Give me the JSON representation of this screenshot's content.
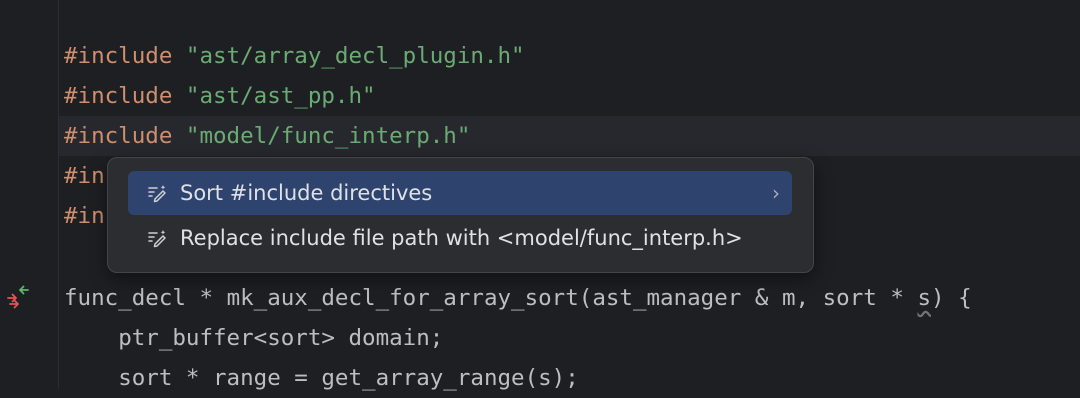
{
  "editor": {
    "lines": [
      {
        "directive": "#include",
        "path": "\"ast/array_decl_plugin.h\""
      },
      {
        "directive": "#include",
        "path": "\"ast/ast_pp.h\""
      },
      {
        "directive": "#include",
        "path": "\"model/func_interp.h\""
      },
      {
        "directive": "#in",
        "path": ""
      },
      {
        "directive": "#in",
        "path": ""
      }
    ],
    "func_line": {
      "ret_type": "func_decl",
      "star1": " * ",
      "name": "mk_aux_decl_for_array_sort",
      "paren_open": "(",
      "param1_type": "ast_manager",
      "amp": " & ",
      "param1_name": "m",
      "comma": ", ",
      "param2_type": "sort",
      "star2": " * ",
      "param2_name": "s",
      "tail": ") {"
    },
    "body_line1": {
      "indent": "    ",
      "type": "ptr_buffer",
      "lt": "<",
      "targ": "sort",
      "gt": ">",
      "rest": " domain;"
    },
    "body_line2": {
      "indent": "    ",
      "type": "sort",
      "star": " * ",
      "rest": "range = get_array_range(s);"
    }
  },
  "popup": {
    "items": [
      {
        "label": "Sort #include directives",
        "icon": "edit-sparkle-icon",
        "has_submenu": true,
        "selected": true
      },
      {
        "label": "Replace include file path with <model/func_interp.h>",
        "icon": "edit-sparkle-icon",
        "has_submenu": false,
        "selected": false
      }
    ],
    "submenu_chevron": "›"
  },
  "colors": {
    "background": "#1e1f22",
    "keyword": "#cf8e6d",
    "string": "#6aab73",
    "selection": "#2e436e",
    "popup_bg": "#2b2d30"
  }
}
